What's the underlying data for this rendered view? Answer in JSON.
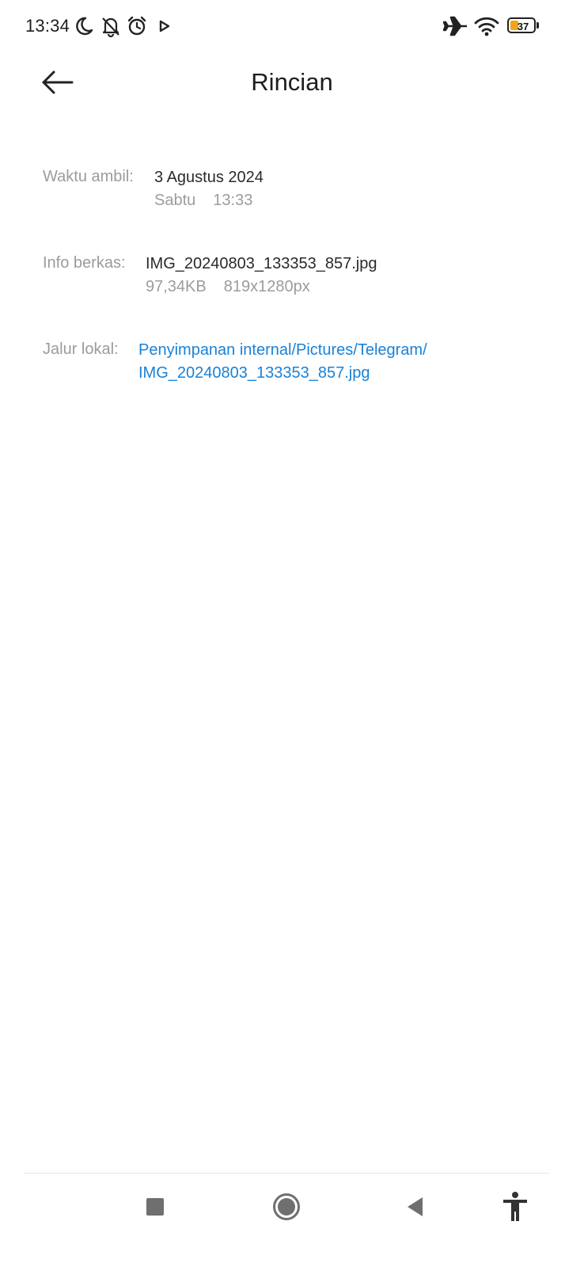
{
  "status_bar": {
    "time": "13:34",
    "battery_percent": "37",
    "battery_level": 0.37,
    "icons": [
      "moon-icon",
      "bell-off-icon",
      "alarm-icon",
      "play-icon",
      "airplane-icon",
      "wifi-icon",
      "battery-icon"
    ]
  },
  "header": {
    "title": "Rincian",
    "back_icon": "arrow-left-icon"
  },
  "details": {
    "taken": {
      "label": "Waktu ambil:",
      "date": "3 Agustus 2024",
      "day": "Sabtu",
      "time": "13:33"
    },
    "file_info": {
      "label": "Info berkas:",
      "name": "IMG_20240803_133353_857.jpg",
      "size": "97,34KB",
      "resolution": "819x1280px"
    },
    "local_path": {
      "label": "Jalur lokal:",
      "line1": "Penyimpanan internal/Pictures/Telegram/",
      "line2": "IMG_20240803_133353_857.jpg"
    }
  },
  "nav_bar": {
    "icons": [
      "recents-square-icon",
      "home-circle-icon",
      "back-triangle-icon",
      "accessibility-icon"
    ]
  },
  "colors": {
    "link": "#1a82d6",
    "label": "#9b9b9b",
    "text": "#2a2a2a",
    "battery": "#f3a41a"
  }
}
